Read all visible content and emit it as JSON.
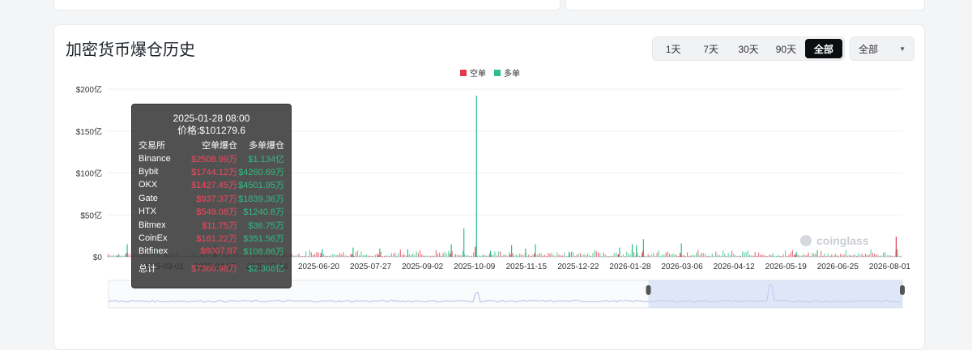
{
  "title": "加密货币爆仓历史",
  "range_buttons": [
    {
      "label": "1天",
      "active": false
    },
    {
      "label": "7天",
      "active": false
    },
    {
      "label": "30天",
      "active": false
    },
    {
      "label": "90天",
      "active": false
    },
    {
      "label": "全部",
      "active": true
    }
  ],
  "exchange_select": {
    "value": "全部"
  },
  "colors": {
    "short": "#e03a4e",
    "long": "#2ebd85",
    "accent": "#0b0e11"
  },
  "chart_data": {
    "type": "bar",
    "legend": {
      "position": "top-center",
      "items": [
        {
          "name": "空单",
          "color": "#e03a4e"
        },
        {
          "name": "多单",
          "color": "#2ebd85"
        }
      ]
    },
    "y_ticks": [
      "$0",
      "$50亿",
      "$100亿",
      "$150亿",
      "$200亿"
    ],
    "ylim": [
      0,
      200
    ],
    "x_ticks": [
      "2025-03-01",
      "2025-04-07",
      "2025-05-14",
      "2025-06-20",
      "2025-07-27",
      "2025-09-02",
      "2025-10-09",
      "2025-11-15",
      "2025-12-22",
      "2026-01-28",
      "2026-03-06",
      "2026-04-12",
      "2026-05-19",
      "2026-06-25",
      "2026-08-01"
    ],
    "x_range": [
      "2025-01-20",
      "2026-08-10"
    ],
    "grid": "horizontal",
    "series": [
      {
        "name": "空单",
        "points": [
          [
            "2025-01-28",
            0.74
          ],
          [
            "2025-02-03",
            4
          ],
          [
            "2025-03-03",
            2.5
          ],
          [
            "2025-04-07",
            5
          ],
          [
            "2025-06-22",
            4.5
          ],
          [
            "2025-07-14",
            3
          ],
          [
            "2025-08-02",
            2.5
          ],
          [
            "2025-09-22",
            3.5
          ],
          [
            "2025-10-10",
            12
          ],
          [
            "2025-11-04",
            3
          ],
          [
            "2025-11-21",
            4
          ],
          [
            "2026-01-20",
            3
          ],
          [
            "2026-02-06",
            5
          ],
          [
            "2026-03-05",
            3.5
          ],
          [
            "2026-05-26",
            2.5
          ],
          [
            "2026-08-06",
            24
          ]
        ]
      },
      {
        "name": "多单",
        "points": [
          [
            "2025-01-28",
            2.37
          ],
          [
            "2025-02-03",
            15
          ],
          [
            "2025-02-25",
            10
          ],
          [
            "2025-03-03",
            8
          ],
          [
            "2025-03-28",
            6
          ],
          [
            "2025-04-07",
            14
          ],
          [
            "2025-05-04",
            5
          ],
          [
            "2025-06-22",
            9
          ],
          [
            "2025-07-14",
            11
          ],
          [
            "2025-08-02",
            10
          ],
          [
            "2025-08-22",
            9
          ],
          [
            "2025-09-22",
            15
          ],
          [
            "2025-10-01",
            34
          ],
          [
            "2025-10-10",
            192
          ],
          [
            "2025-10-20",
            7
          ],
          [
            "2025-11-04",
            14
          ],
          [
            "2025-11-14",
            10
          ],
          [
            "2025-11-21",
            15
          ],
          [
            "2025-12-15",
            6
          ],
          [
            "2026-01-20",
            11
          ],
          [
            "2026-01-29",
            15
          ],
          [
            "2026-02-01",
            14
          ],
          [
            "2026-02-06",
            21
          ],
          [
            "2026-03-05",
            16
          ],
          [
            "2026-05-26",
            6
          ],
          [
            "2026-06-10",
            8
          ],
          [
            "2026-08-06",
            9
          ]
        ]
      }
    ],
    "watermark": "coinglass",
    "tooltip": {
      "date": "2025-01-28 08:00",
      "price": "价格:$101279.6",
      "header": {
        "exchange": "交易所",
        "short": "空单爆仓",
        "long": "多单爆仓"
      },
      "rows": [
        {
          "exchange": "Binance",
          "short": "$2508.99万",
          "long": "$1.134亿"
        },
        {
          "exchange": "Bybit",
          "short": "$1744.12万",
          "long": "$4260.69万"
        },
        {
          "exchange": "OKX",
          "short": "$1427.45万",
          "long": "$4501.95万"
        },
        {
          "exchange": "Gate",
          "short": "$937.37万",
          "long": "$1839.36万"
        },
        {
          "exchange": "HTX",
          "short": "$549.08万",
          "long": "$1240.8万"
        },
        {
          "exchange": "Bitmex",
          "short": "$11.75万",
          "long": "$36.75万"
        },
        {
          "exchange": "CoinEx",
          "short": "$181.22万",
          "long": "$351.56万"
        },
        {
          "exchange": "Bitfinex",
          "short": "$6007.97",
          "long": "$108.86万"
        }
      ],
      "total": {
        "label": "总计",
        "short": "$7360.98万",
        "long": "$2.368亿"
      }
    },
    "zoom_window": {
      "start": "2026-02-10",
      "end": "2026-08-10"
    }
  }
}
